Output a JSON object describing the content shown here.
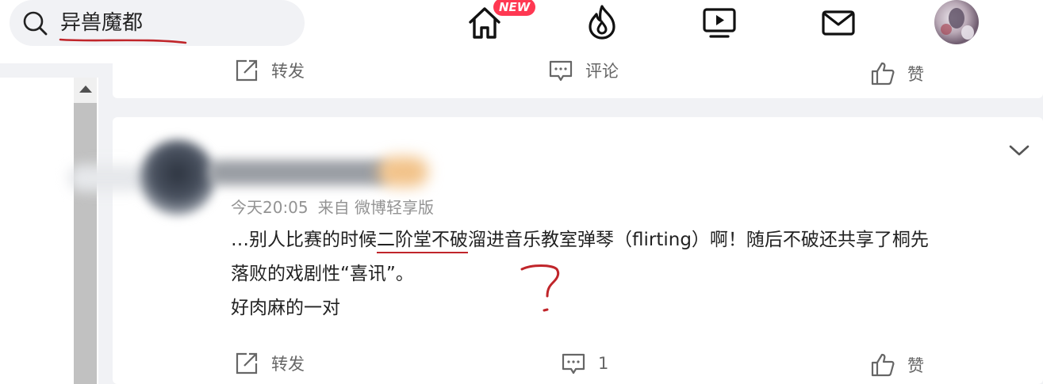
{
  "search": {
    "query": "异兽魔都"
  },
  "nav": {
    "new_badge": "NEW"
  },
  "colors": {
    "accent_red": "#ff3852",
    "annotation_red": "#c0252a",
    "meta_gray": "#939393"
  },
  "prev_card": {
    "actions": {
      "repost": "转发",
      "comment": "评论",
      "like": "赞"
    }
  },
  "post": {
    "time": "今天20:05",
    "source": "来自 微博轻享版",
    "text": {
      "line1_before": "…别人比赛的时候",
      "line1_underlined": "二阶堂不破",
      "line1_after": "溜进音乐教室弹琴（flirting）啊！随后不破还共享了桐先",
      "line2": "落败的戏剧性“喜讯”。",
      "line3": "好肉麻的一对"
    },
    "actions": {
      "repost": "转发",
      "comment_count": "1",
      "like": "赞"
    }
  }
}
